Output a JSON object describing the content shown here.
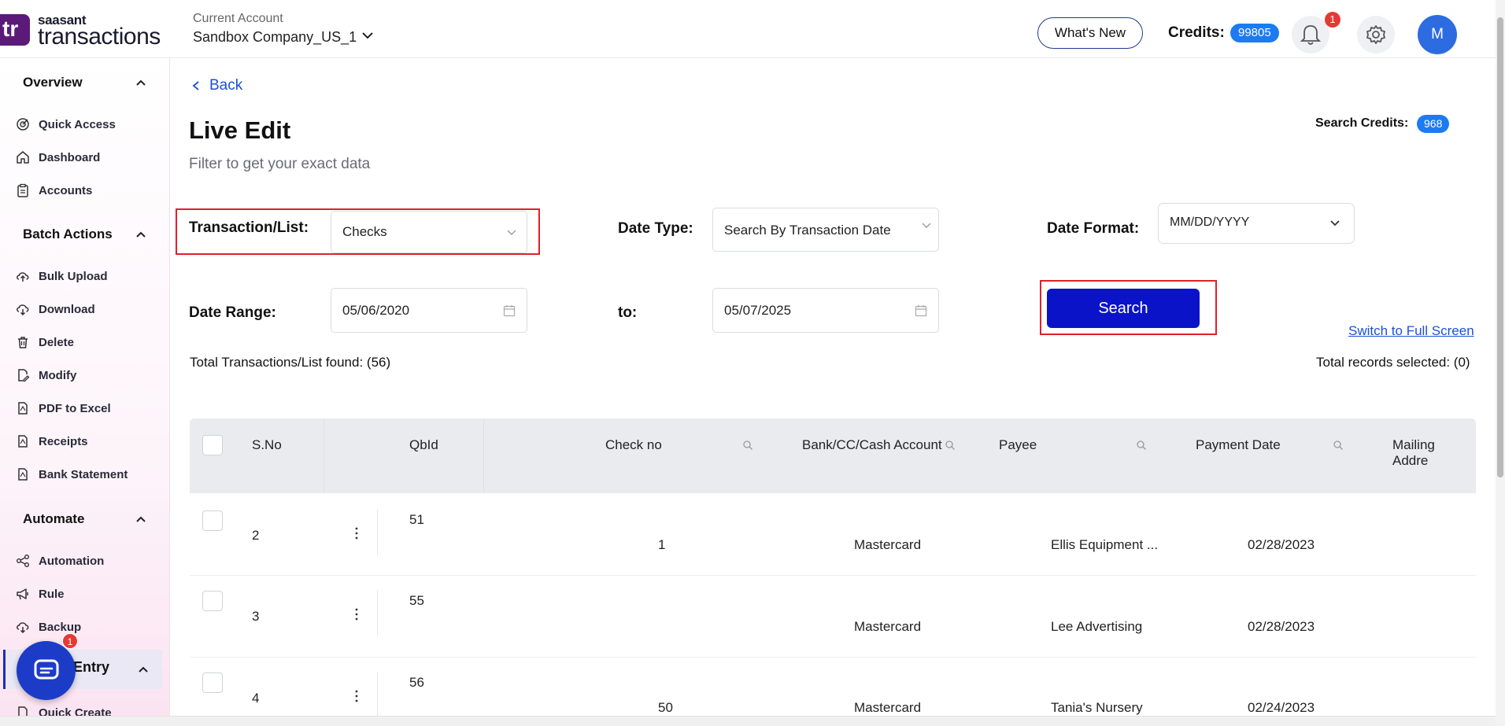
{
  "header": {
    "logo_mark": "tr",
    "logo_small": "saasant",
    "logo_big": "transactions",
    "account_label": "Current Account",
    "account_name": "Sandbox Company_US_1",
    "whats_new": "What's New",
    "credits_label": "Credits:",
    "credits_value": "99805",
    "notification_count": "1",
    "avatar_initial": "M"
  },
  "sidebar": {
    "sections": [
      {
        "title": "Overview",
        "items": [
          "Quick Access",
          "Dashboard",
          "Accounts"
        ]
      },
      {
        "title": "Batch Actions",
        "items": [
          "Bulk Upload",
          "Download",
          "Delete",
          "Modify",
          "PDF to Excel",
          "Receipts",
          "Bank Statement"
        ]
      },
      {
        "title": "Automate",
        "items": [
          "Automation",
          "Rule",
          "Backup"
        ]
      }
    ],
    "manual_entry_partial": "Entry",
    "quick_create": "Quick Create",
    "chat_badge": "1"
  },
  "page": {
    "back": "Back",
    "title": "Live Edit",
    "subtitle": "Filter to get your exact data",
    "search_credits_label": "Search Credits:",
    "search_credits_value": "968"
  },
  "filters": {
    "transaction_label": "Transaction/List:",
    "transaction_value": "Checks",
    "date_type_label": "Date Type:",
    "date_type_value": "Search By Transaction Date",
    "date_format_label": "Date Format:",
    "date_format_value": "MM/DD/YYYY",
    "date_range_label": "Date Range:",
    "date_from": "05/06/2020",
    "to_label": "to:",
    "date_to": "05/07/2025",
    "search_button": "Search",
    "full_screen_link": "Switch to Full Screen",
    "total_found": "Total Transactions/List found: (56)",
    "total_selected": "Total records selected: (0)"
  },
  "table": {
    "columns": [
      "S.No",
      "QbId",
      "Check no",
      "Bank/CC/Cash Account",
      "Payee",
      "Payment Date",
      "Mailing Addre"
    ],
    "rows": [
      {
        "sno": "2",
        "qbid": "51",
        "check_no": "1",
        "account": "Mastercard",
        "payee": "Ellis Equipment ...",
        "date": "02/28/2023"
      },
      {
        "sno": "3",
        "qbid": "55",
        "check_no": "",
        "account": "Mastercard",
        "payee": "Lee Advertising",
        "date": "02/28/2023"
      },
      {
        "sno": "4",
        "qbid": "56",
        "check_no": "50",
        "account": "Mastercard",
        "payee": "Tania's Nursery",
        "date": "02/24/2023"
      }
    ]
  }
}
